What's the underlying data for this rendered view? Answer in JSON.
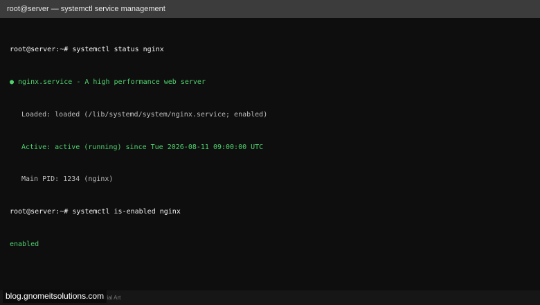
{
  "window": {
    "title": "root@server — systemctl service management"
  },
  "terminal": {
    "lines": [
      {
        "prompt": "root@server:~# ",
        "command": "systemctl status nginx"
      },
      {
        "text": "● nginx.service - A high performance web server"
      },
      {
        "text": "Loaded: loaded (/lib/systemd/system/nginx.service; enabled)"
      },
      {
        "text": "Active: active (running) since Tue 2026-08-11 09:00:00 UTC"
      },
      {
        "text": "Main PID: 1234 (nginx)"
      },
      {
        "prompt": "root@server:~# ",
        "command": "systemctl is-enabled nginx"
      },
      {
        "text": "enabled"
      }
    ]
  },
  "footer": {
    "credit": "Tutorial Art",
    "watermark": "blog.gnomeitsolutions.com"
  },
  "colors": {
    "background": "#0e0e0e",
    "titlebar": "#3c3c3c",
    "green": "#4fd16d",
    "grey": "#bdbdbd"
  }
}
